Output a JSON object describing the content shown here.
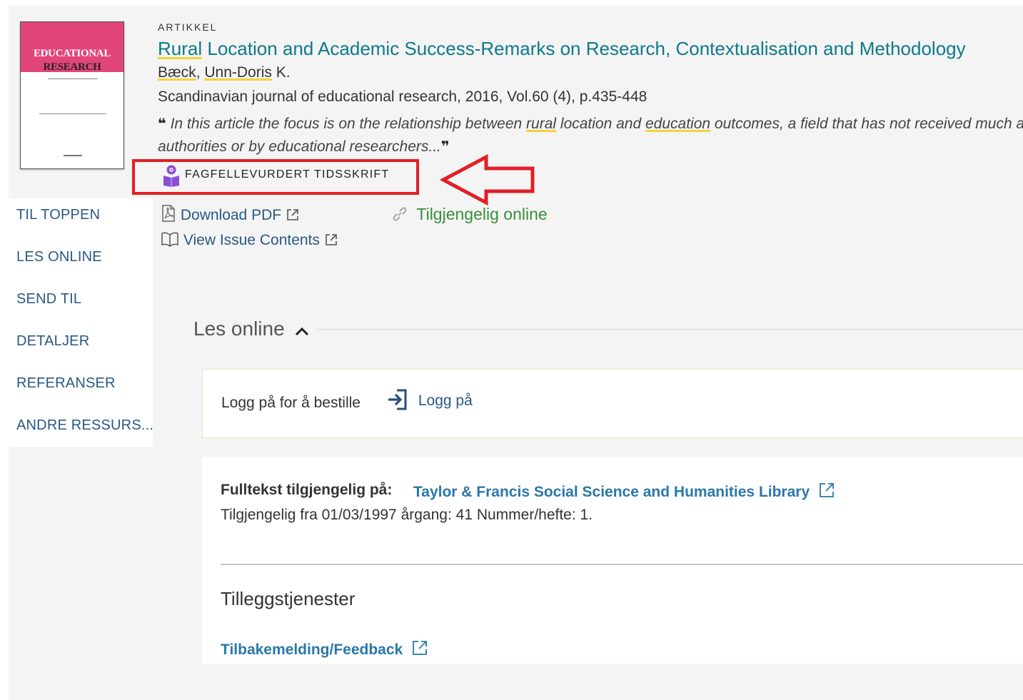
{
  "record": {
    "type_label": "ARTIKKEL",
    "title_first": "Rural",
    "title_rest": " Location and Academic Success-Remarks on Research, Contextualisation and Methodology",
    "author_last": "Bæck",
    "author_sep": ", ",
    "author_first": "Unn-Doris",
    "author_init": " K.",
    "source": "Scandinavian journal of educational research, 2016, Vol.60 (4), p.435-448",
    "snippet_1": " In this article the focus is on the relationship between ",
    "snippet_hl1": "rural",
    "snippet_2": " location and ",
    "snippet_hl2": "education",
    "snippet_3": " outcomes, a field that has not received much attention from research",
    "snippet_4": "authorities or by educational researchers...",
    "quote_open": "❝",
    "quote_close": "❞",
    "peer_reviewed": "FAGFELLEVURDERT TIDSSKRIFT"
  },
  "cover": {
    "title_line1": "EDUCATIONAL",
    "title_line2": "RESEARCH",
    "band_color": "#e2457a"
  },
  "nav": {
    "items": [
      {
        "label": "TIL TOPPEN"
      },
      {
        "label": "LES ONLINE"
      },
      {
        "label": "SEND TIL"
      },
      {
        "label": "DETALJER"
      },
      {
        "label": "REFERANSER"
      },
      {
        "label": "ANDRE RESSURS..."
      }
    ]
  },
  "links": {
    "download_pdf": "Download PDF",
    "view_issue": "View Issue Contents",
    "availability": "Tilgjengelig online"
  },
  "section": {
    "title": "Les online",
    "login_prompt": "Logg på for å bestille",
    "login_button": "Logg på",
    "fulltext_label": "Fulltekst tilgjengelig på:",
    "fulltext_link": "Taylor & Francis Social Science and Humanities Library",
    "coverage": "Tilgjengelig fra 01/03/1997 årgang: 41 Nummer/hefte: 1.",
    "extra_title": "Tilleggstjenester",
    "feedback_link": "Tilbakemelding/Feedback"
  },
  "colors": {
    "title": "#0d7a8a",
    "link": "#2a5886",
    "available": "#3a8f3a",
    "annotation": "#e02027",
    "highlight": "#f2d33c"
  },
  "icons": [
    "book-reader-icon",
    "pdf-icon",
    "external-link-icon",
    "open-book-icon",
    "link-icon",
    "chevron-up-icon",
    "sign-in-icon"
  ]
}
